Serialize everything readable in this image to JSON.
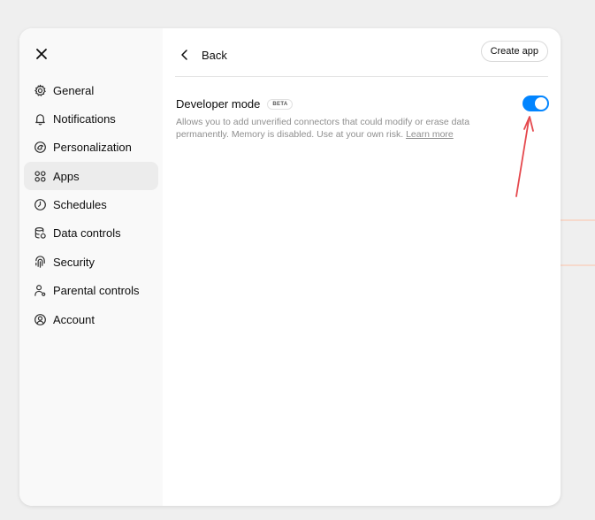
{
  "sidebar": {
    "close_label": "Close",
    "items": [
      {
        "label": "General",
        "icon": "gear-icon"
      },
      {
        "label": "Notifications",
        "icon": "bell-icon"
      },
      {
        "label": "Personalization",
        "icon": "personalization-icon"
      },
      {
        "label": "Apps",
        "icon": "apps-grid-icon",
        "active": true
      },
      {
        "label": "Schedules",
        "icon": "clock-icon"
      },
      {
        "label": "Data controls",
        "icon": "database-icon"
      },
      {
        "label": "Security",
        "icon": "fingerprint-icon"
      },
      {
        "label": "Parental controls",
        "icon": "parental-icon"
      },
      {
        "label": "Account",
        "icon": "account-icon"
      }
    ]
  },
  "header": {
    "back_label": "Back",
    "create_app_label": "Create app"
  },
  "developer_mode": {
    "title": "Developer mode",
    "badge": "BETA",
    "description": "Allows you to add unverified connectors that could modify or erase data permanently. Memory is disabled. Use at your own risk.",
    "learn_more": "Learn more",
    "enabled": true,
    "toggle_color": "#0285ff"
  },
  "annotation": {
    "arrow_color": "#e5484d"
  }
}
